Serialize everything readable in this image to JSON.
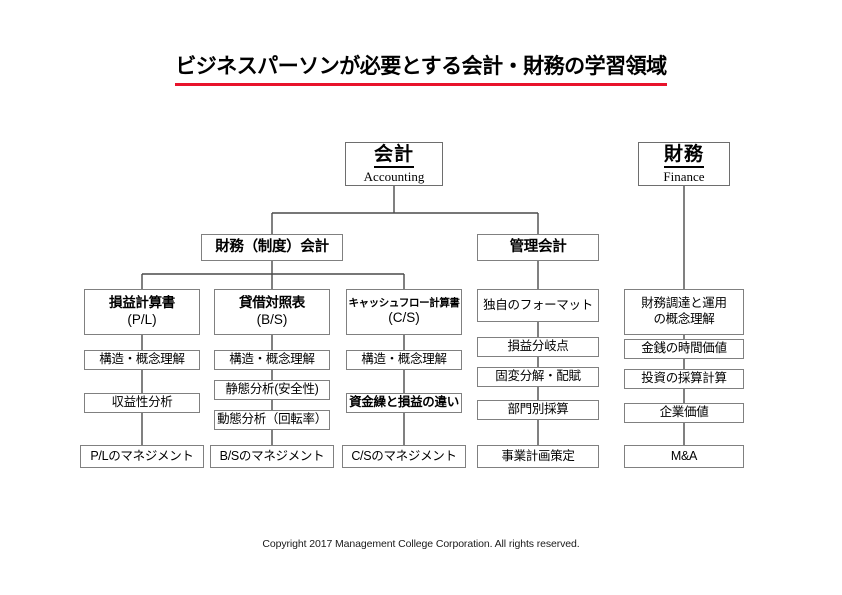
{
  "title": "ビジネスパーソンが必要とする会計・財務の学習領域",
  "accent_color": "#e8132b",
  "line_color": "#4a4a4a",
  "footer": "Copyright 2017 Management College Corporation. All rights reserved.",
  "roots": {
    "accounting": {
      "ja": "会計",
      "en": "Accounting"
    },
    "finance": {
      "ja": "財務",
      "en": "Finance"
    }
  },
  "level2": {
    "financial_accounting": "財務（制度）会計",
    "management_accounting": "管理会計"
  },
  "columns": [
    {
      "id": "pl",
      "header_ja": "損益計算書",
      "header_en": "(P/L)",
      "items": [
        "構造・概念理解",
        "収益性分析",
        "P/Lのマネジメント"
      ]
    },
    {
      "id": "bs",
      "header_ja": "貸借対照表",
      "header_en": "(B/S)",
      "items": [
        "構造・概念理解",
        "静態分析(安全性)",
        "動態分析（回転率）",
        "B/Sのマネジメント"
      ]
    },
    {
      "id": "cs",
      "header_ja": "キャッシュフロー計算書",
      "header_en": "(C/S)",
      "items": [
        "構造・概念理解",
        "資金繰と損益の違い",
        "C/Sのマネジメント"
      ]
    },
    {
      "id": "mgmt",
      "header_ja": "独自のフォーマット",
      "header_en": "",
      "items": [
        "損益分岐点",
        "固変分解・配賦",
        "部門別採算",
        "事業計画策定"
      ]
    },
    {
      "id": "fin",
      "header_ja": "財務調達と運用\nの概念理解",
      "header_en": "",
      "items": [
        "金銭の時間価値",
        "投資の採算計算",
        "企業価値",
        "M&A"
      ]
    }
  ],
  "column_headers": {
    "pl_line1": "損益計算書",
    "pl_line2": "(P/L)",
    "bs_line1": "貸借対照表",
    "bs_line2": "(B/S)",
    "cs_line1": "キャッシュフロー計算書",
    "cs_line2": "(C/S)",
    "mgmt_line1": "独自のフォーマット",
    "fin_line1": "財務調達と運用",
    "fin_line2": "の概念理解"
  },
  "cells": {
    "pl_1": "構造・概念理解",
    "pl_2": "収益性分析",
    "pl_3": "P/Lのマネジメント",
    "bs_1": "構造・概念理解",
    "bs_2": "静態分析(安全性)",
    "bs_3": "動態分析（回転率）",
    "bs_4": "B/Sのマネジメント",
    "cs_1": "構造・概念理解",
    "cs_2": "資金繰と損益の違い",
    "cs_3": "C/Sのマネジメント",
    "mgmt_1": "損益分岐点",
    "mgmt_2": "固変分解・配賦",
    "mgmt_3": "部門別採算",
    "mgmt_4": "事業計画策定",
    "fin_1": "金銭の時間価値",
    "fin_2": "投資の採算計算",
    "fin_3": "企業価値",
    "fin_4": "M&A"
  }
}
